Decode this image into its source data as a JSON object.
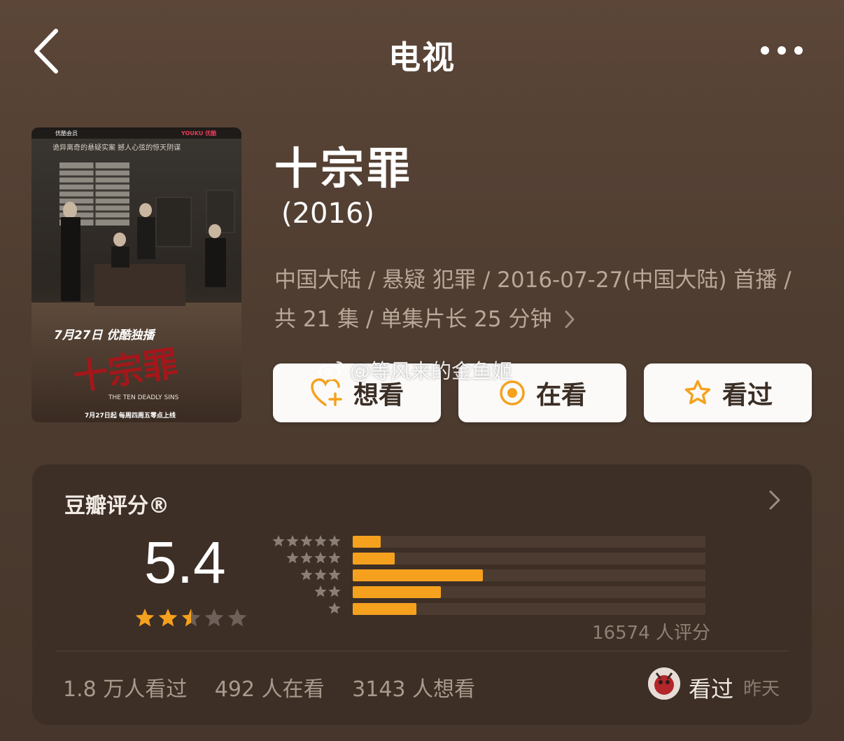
{
  "header": {
    "title": "电视",
    "back_icon": "chevron-left-icon",
    "more_icon": "more-horizontal-icon"
  },
  "poster": {
    "tagline": "诡异离奇的悬疑实案 撼人心弦的惊天阴谋",
    "brand_left": "优酷会员",
    "brand_right": "YOUKU 优酷",
    "exclusive": "7月27日 优酷独播",
    "title_art": "十宗罪",
    "subtitle_art": "THE TEN DEADLY SINS",
    "schedule": "7月27日起 每周四周五零点上线"
  },
  "show": {
    "title": "十宗罪",
    "year": "(2016)",
    "meta_line1": "中国大陆 / 悬疑 犯罪 / 2016-07-27(中国大陆) 首播 /",
    "meta_line2": "共 21 集 / 单集片长 25 分钟"
  },
  "actions": {
    "want": "想看",
    "doing": "在看",
    "done": "看过"
  },
  "watermark": "@等风来的金鱼姬",
  "rating": {
    "label": "豆瓣评分®",
    "score": "5.4",
    "stars": 2.5,
    "distribution": [
      {
        "stars": 5,
        "fraction": 0.08
      },
      {
        "stars": 4,
        "fraction": 0.12
      },
      {
        "stars": 3,
        "fraction": 0.37
      },
      {
        "stars": 2,
        "fraction": 0.25
      },
      {
        "stars": 1,
        "fraction": 0.18
      }
    ],
    "count_text": "16574 人评分"
  },
  "stats": {
    "seen": "1.8 万人看过",
    "doing": "492 人在看",
    "want": "3143 人想看"
  },
  "user": {
    "status": "看过",
    "time": "昨天"
  },
  "colors": {
    "accent": "#f5a11e",
    "card_bg": "#3d2f26",
    "button_bg": "#fbfaf9"
  }
}
